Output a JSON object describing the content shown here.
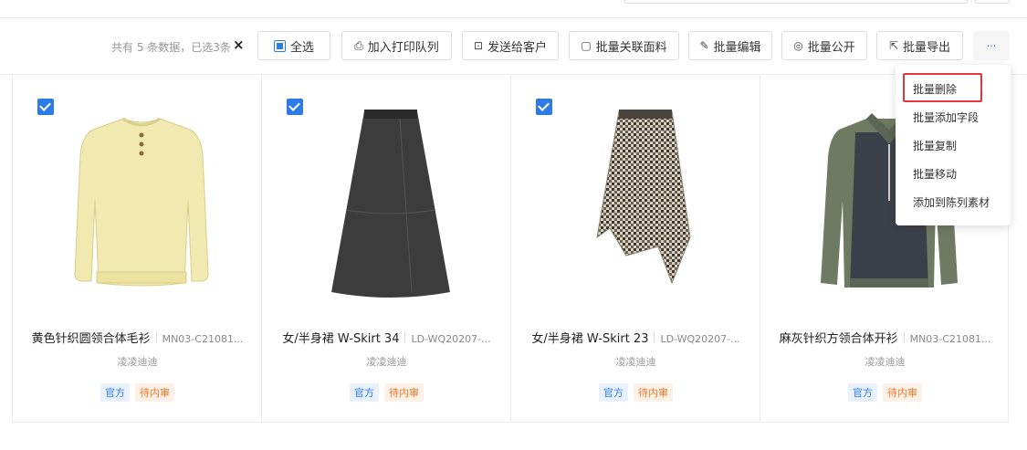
{
  "toolbar": {
    "count_text": "共有 5 条数据，已选3条",
    "clear_icon": "×",
    "buttons": {
      "select_all": "全选",
      "print_queue": "加入打印队列",
      "send_customer": "发送给客户",
      "link_fabric": "批量关联面料",
      "batch_edit": "批量编辑",
      "batch_public": "批量公开",
      "batch_export": "批量导出",
      "more": "···"
    }
  },
  "icons": {
    "print": "printer-icon",
    "send": "send-icon",
    "link": "link-icon",
    "edit": "pencil-icon",
    "public": "eye-icon",
    "export": "export-icon"
  },
  "menu": {
    "items": [
      "批量删除",
      "批量添加字段",
      "批量复制",
      "批量移动",
      "添加到陈列素材"
    ]
  },
  "cards": [
    {
      "name": "黄色针织圆领合体毛衫",
      "code": "MN03-C21081...",
      "owner": "凌凌迪迪",
      "tags": [
        "官方",
        "待内审"
      ],
      "checked": true
    },
    {
      "name": "女/半身裙 W-Skirt 34",
      "code": "LD-WQ20207-...",
      "owner": "凌凌迪迪",
      "tags": [
        "官方",
        "待内审"
      ],
      "checked": true
    },
    {
      "name": "女/半身裙 W-Skirt 23",
      "code": "LD-WQ20207-...",
      "owner": "凌凌迪迪",
      "tags": [
        "官方",
        "待内审"
      ],
      "checked": true
    },
    {
      "name": "麻灰针织方领合体开衫",
      "code": "MN03-C21081...",
      "owner": "凌凌迪迪",
      "tags": [
        "官方",
        "待内审"
      ],
      "checked": false
    }
  ],
  "colors": {
    "accent": "#2d7be5",
    "tag_blue_bg": "#e8f1fd",
    "tag_orange_text": "#ee7a2c",
    "highlight_red": "#e0393b"
  }
}
